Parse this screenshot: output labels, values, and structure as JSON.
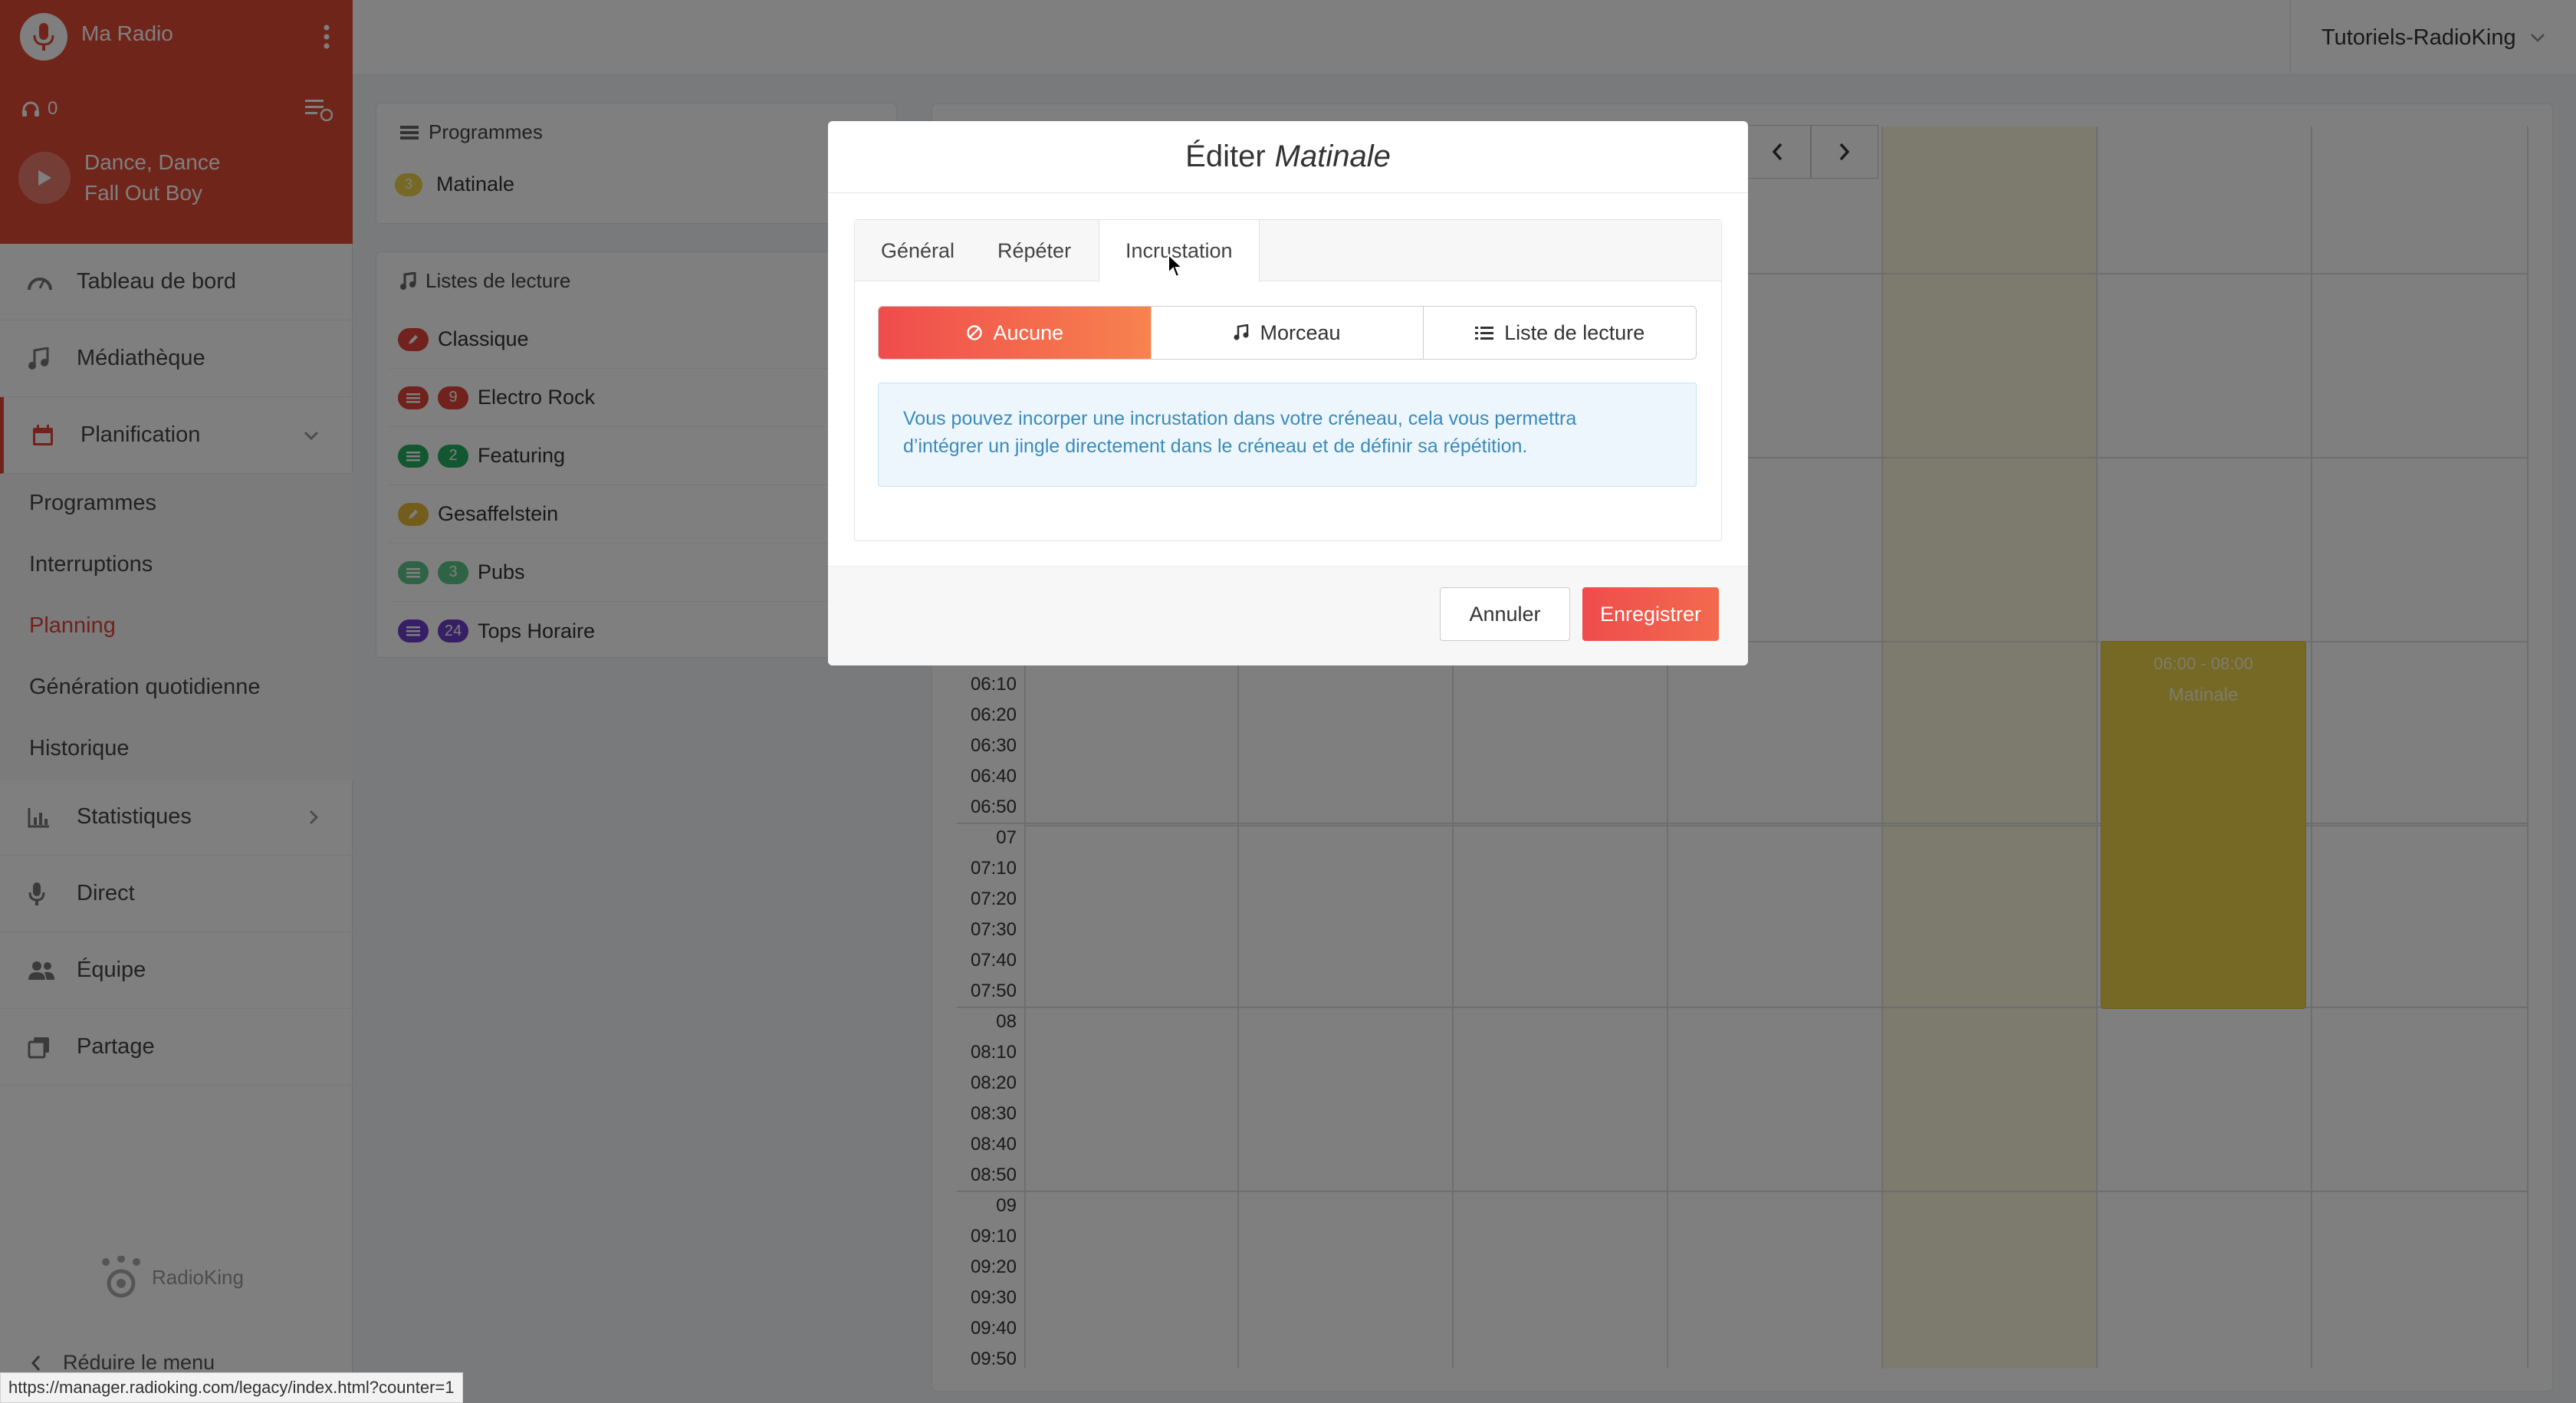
{
  "app": {
    "station_name": "Ma Radio",
    "account": "Tutoriels-RadioKing",
    "brand": "RadioKing",
    "accent": "#e4453a"
  },
  "player": {
    "listeners": "0",
    "track_title": "Dance, Dance",
    "track_artist": "Fall Out Boy"
  },
  "sidebar": {
    "items": [
      {
        "label": "Tableau de bord",
        "icon": "dashboard-icon"
      },
      {
        "label": "Médiathèque",
        "icon": "music-icon"
      },
      {
        "label": "Planification",
        "icon": "calendar-icon"
      },
      {
        "label": "Statistiques",
        "icon": "bar-chart-icon"
      },
      {
        "label": "Direct",
        "icon": "microphone-icon"
      },
      {
        "label": "Équipe",
        "icon": "team-icon"
      },
      {
        "label": "Partage",
        "icon": "share-icon"
      }
    ],
    "subitems": [
      "Programmes",
      "Interruptions",
      "Planning",
      "Génération quotidienne",
      "Historique"
    ],
    "reduce_label": "Réduire le menu"
  },
  "programmes_panel": {
    "title": "Programmes",
    "items": [
      {
        "label": "Matinale",
        "count": "3"
      }
    ]
  },
  "playlists_panel": {
    "title": "Listes de lecture",
    "items": [
      {
        "label": "Classique",
        "count": ""
      },
      {
        "label": "Electro Rock",
        "count": "9"
      },
      {
        "label": "Featuring",
        "count": "2"
      },
      {
        "label": "Gesaffelstein",
        "count": ""
      },
      {
        "label": "Pubs",
        "count": "3"
      },
      {
        "label": "Tops Horaire",
        "count": "24"
      }
    ]
  },
  "calendar": {
    "times": [
      "06:10",
      "06:20",
      "06:30",
      "06:40",
      "06:50",
      "07",
      "07:10",
      "07:20",
      "07:30",
      "07:40",
      "07:50",
      "08",
      "08:10",
      "08:20",
      "08:30",
      "08:40",
      "08:50",
      "09",
      "09:10",
      "09:20",
      "09:30",
      "09:40",
      "09:50"
    ],
    "event": {
      "time": "06:00 - 08:00",
      "name": "Matinale",
      "color": "#ecd04a"
    }
  },
  "modal": {
    "title_prefix": "Éditer",
    "title_name": "Matinale",
    "tabs": [
      "Général",
      "Répéter",
      "Incrustation"
    ],
    "active_tab": "Incrustation",
    "options": [
      "Aucune",
      "Morceau",
      "Liste de lecture"
    ],
    "selected_option": "Aucune",
    "info_line1": "Vous pouvez incorper une incrustation dans votre créneau, cela vous permettra",
    "info_line2": "d’intégrer un jingle directement dans le créneau et de définir sa répétition.",
    "cancel": "Annuler",
    "save": "Enregistrer"
  },
  "status_url": "https://manager.radioking.com/legacy/index.html?counter=1"
}
